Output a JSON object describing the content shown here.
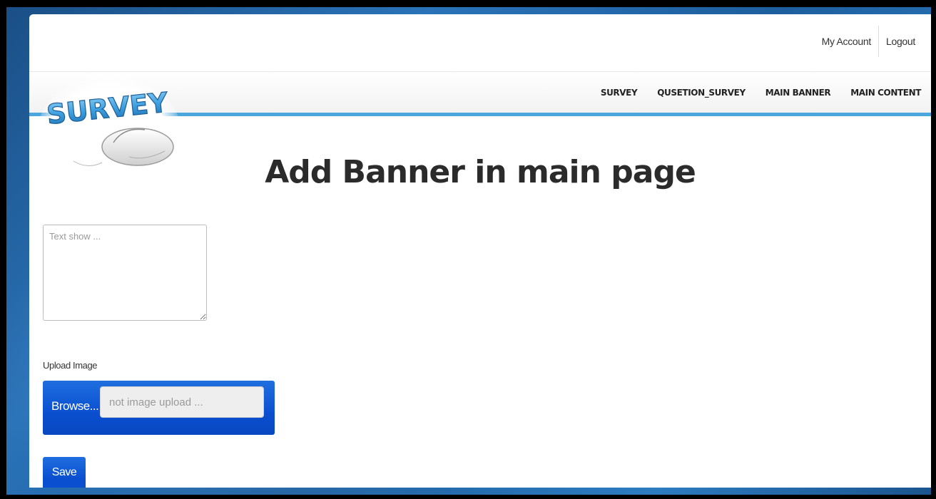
{
  "header": {
    "account_links": [
      "My Account",
      "Logout"
    ]
  },
  "nav": {
    "items": [
      "SURVEY",
      "QUSETION_SURVEY",
      "MAIN BANNER",
      "MAIN CONTENT"
    ]
  },
  "logo": {
    "text": "SURVEY"
  },
  "main": {
    "title": "Add Banner in main page",
    "textarea_placeholder": "Text show ...",
    "upload_label": "Upload Image",
    "browse_label": "Browse...",
    "file_placeholder": "not image upload ...",
    "save_label": "Save"
  },
  "colors": {
    "accent_blue": "#0a4fd0",
    "nav_bar_blue": "#4aa6dc",
    "title_text": "#2b2b2b"
  }
}
